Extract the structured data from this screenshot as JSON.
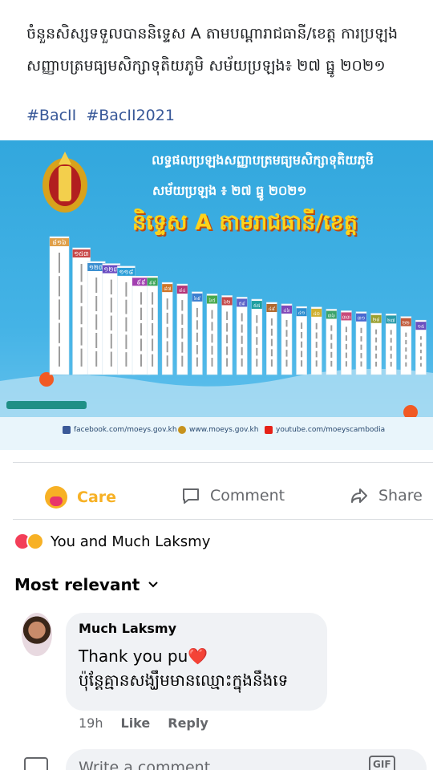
{
  "post": {
    "text_line1": "ចំនួនសិស្សទទួលបាននិទ្ទេស A តាមបណ្តារាជធានី/ខេត្ត ការប្រឡង",
    "text_line2": "សញ្ញាបត្រមធ្យមសិក្សាទុតិយភូមិ សម័យប្រឡង៖ ២៧ ធ្នូ ២០២១",
    "hashtags": [
      "#BacII",
      "#BacII2021"
    ]
  },
  "image": {
    "title1": "លទ្ធផលប្រឡងសញ្ញាបត្រមធ្យមសិក្សាទុតិយភូមិ",
    "title2": "សម័យប្រឡង ៖ ២៧ ធ្នូ ២០២១",
    "title3": "និទ្ទេស A តាមរាជធានី/ខេត្ត",
    "bar_labels": [
      "៨១៦",
      "១៥៣",
      "១២៧",
      "១២៣",
      "១១៨",
      "៩៩",
      "៩៩",
      "៨៧",
      "៨៤",
      "៦៩",
      "៦៥",
      "៦២",
      "៥៩",
      "៥៥",
      "៤៩",
      "៤៦",
      "៤១",
      "៤០",
      "៣៦",
      "៣៣",
      "៣១",
      "២៨",
      "២៧",
      "២២",
      "១៥"
    ],
    "bar_values": [
      816,
      153,
      127,
      123,
      118,
      99,
      99,
      87,
      84,
      69,
      65,
      62,
      59,
      55,
      49,
      46,
      41,
      40,
      36,
      33,
      31,
      28,
      27,
      22,
      15
    ],
    "links": [
      "facebook.com/moeys.gov.kh",
      "www.moeys.gov.kh",
      "youtube.com/moeyscambodia"
    ]
  },
  "actions": {
    "care": "Care",
    "comment": "Comment",
    "share": "Share"
  },
  "reactions": {
    "summary": "You and Much Laksmy"
  },
  "sort": {
    "label": "Most relevant"
  },
  "comment": {
    "author": "Much Laksmy",
    "line1": "Thank you pu❤️",
    "line2": "ប៉ុន្តែគ្មានសង្ឃឹមមានឈ្មោះក្នុងនឹងទេ",
    "time": "19h",
    "like": "Like",
    "reply": "Reply"
  },
  "composer": {
    "placeholder": "Write a comment...",
    "gif": "GIF"
  }
}
